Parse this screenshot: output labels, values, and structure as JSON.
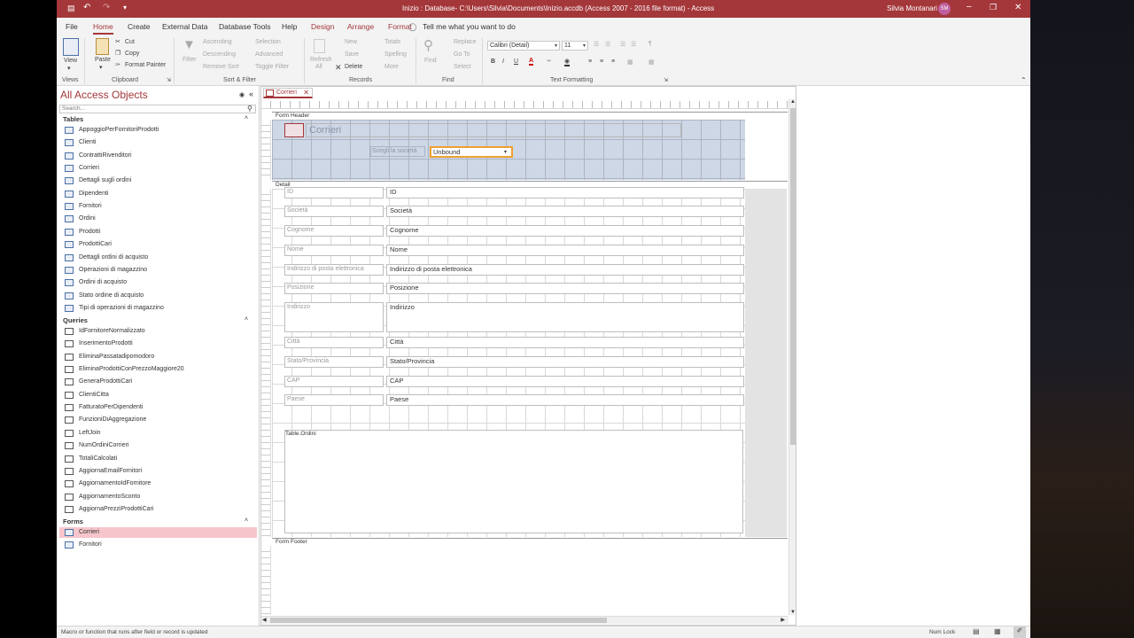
{
  "window": {
    "title": "Inizio : Database- C:\\Users\\Silvia\\Documents\\Inizio.accdb (Access 2007 - 2016 file format)  -  Access",
    "user": "Silvia Montanari",
    "user_initials": "SM"
  },
  "menu": {
    "file": "File",
    "home": "Home",
    "create": "Create",
    "external": "External Data",
    "dbtools": "Database Tools",
    "help": "Help",
    "design": "Design",
    "arrange": "Arrange",
    "format": "Format",
    "tellme": "Tell me what you want to do"
  },
  "ribbon": {
    "view": "View",
    "paste": "Paste",
    "cut": "Cut",
    "copy": "Copy",
    "format_painter": "Format Painter",
    "filter": "Filter",
    "ascending": "Ascending",
    "descending": "Descending",
    "remove_sort": "Remove Sort",
    "selection": "Selection",
    "advanced": "Advanced",
    "toggle_filter": "Toggle Filter",
    "refresh": "Refresh",
    "refresh_all": "All",
    "new": "New",
    "save": "Save",
    "delete": "Delete",
    "totals": "Totals",
    "spelling": "Spelling",
    "more": "More",
    "find": "Find",
    "replace": "Replace",
    "goto": "Go To",
    "select": "Select",
    "font_name": "Calibri (Detail)",
    "font_size": "11",
    "bold": "B",
    "italic": "I",
    "underline": "U",
    "groups": {
      "views": "Views",
      "clipboard": "Clipboard",
      "sortfilter": "Sort & Filter",
      "records": "Records",
      "find": "Find",
      "textformatting": "Text Formatting"
    }
  },
  "nav": {
    "title": "All Access Objects",
    "search_placeholder": "Search...",
    "tables_label": "Tables",
    "queries_label": "Queries",
    "forms_label": "Forms",
    "tables": [
      "AppoggioPerFornitoriProdotti",
      "Clienti",
      "ContrattiRivenditori",
      "Corrieri",
      "Dettagli sugli ordini",
      "Dipendenti",
      "Fornitori",
      "Ordini",
      "Prodotti",
      "ProdottiCari",
      "Dettagli ordini di acquisto",
      "Operazioni di magazzino",
      "Ordini di acquisto",
      "Stato ordine di acquisto",
      "Tipi di operazioni di magazzino"
    ],
    "queries": [
      "IdFornitoreNormalizzato",
      "InserimentoProdotti",
      "EliminaPassatadipomodoro",
      "EliminaProdottiConPrezzoMaggiore20",
      "GeneraProdottiCari",
      "ClientiCitta",
      "FatturatoPerDipendenti",
      "FunzioniDiAggregazione",
      "LeftJoin",
      "NumOrdiniCorrieri",
      "TotaliCalcolati",
      "AggiornaEmailFornitori",
      "AggiornamentoIdFornitore",
      "AggiornamentoSconto",
      "AggiornaPrezziProdottiCari"
    ],
    "forms": [
      "Corrieri",
      "Fornitori"
    ]
  },
  "doc": {
    "tab": "Corrieri",
    "form_header": "Form Header",
    "detail": "Detail",
    "form_footer": "Form Footer",
    "form_title": "Corrieri",
    "combo_label": "Scegli la società",
    "combo_value": "Unbound",
    "subform_label": "Table.Ordini",
    "fields": [
      {
        "label": "ID",
        "value": "ID"
      },
      {
        "label": "Società",
        "value": "Società"
      },
      {
        "label": "Cognome",
        "value": "Cognome"
      },
      {
        "label": "Nome",
        "value": "Nome"
      },
      {
        "label": "Indirizzo di posta elettronica",
        "value": "Indirizzo di posta elettronica"
      },
      {
        "label": "Posizione",
        "value": "Posizione"
      },
      {
        "label": "Indirizzo",
        "value": "Indirizzo"
      },
      {
        "label": "Città",
        "value": "Città"
      },
      {
        "label": "Stato/Provincia",
        "value": "Stato/Provincia"
      },
      {
        "label": "CAP",
        "value": "CAP"
      },
      {
        "label": "Paese",
        "value": "Paese"
      }
    ]
  },
  "status": {
    "message": "Macro or function that runs after field or record is updated",
    "numlock": "Num Lock"
  }
}
